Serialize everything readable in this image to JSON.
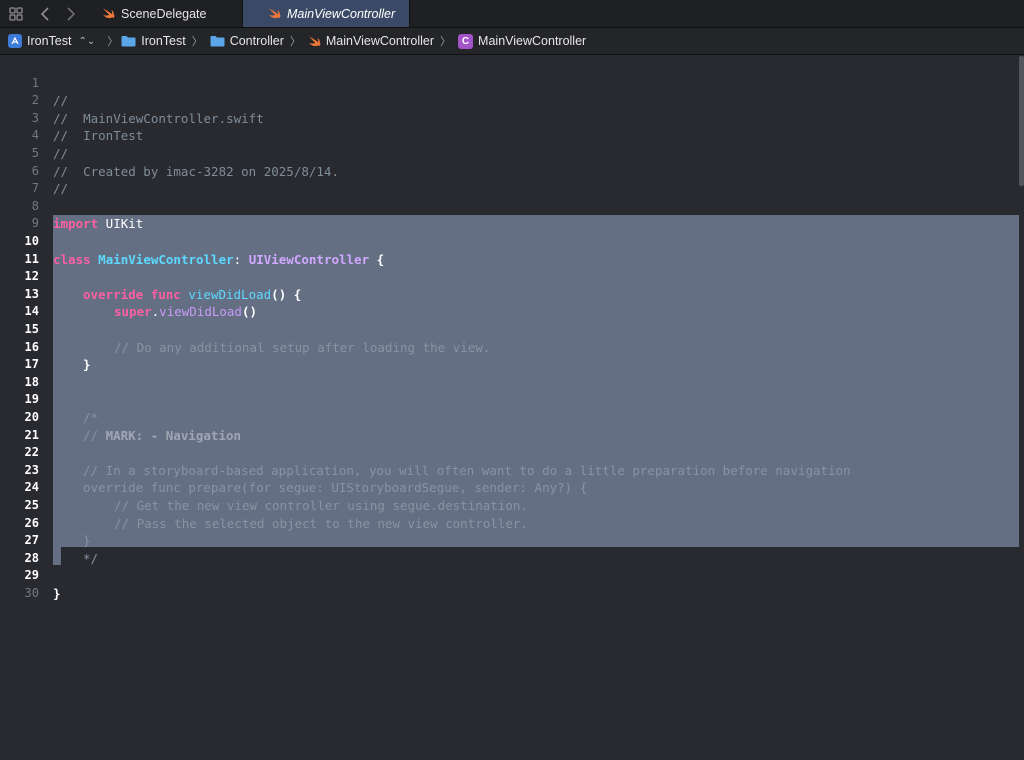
{
  "tabs": {
    "items": [
      {
        "label": "SceneDelegate",
        "icon": "swift-icon",
        "active": false
      },
      {
        "label": "MainViewController",
        "icon": "swift-icon",
        "active": true
      }
    ]
  },
  "breadcrumb": {
    "project": "IronTest",
    "folder1": "IronTest",
    "folder2": "Controller",
    "file": "MainViewController",
    "symbol": "MainViewController",
    "symbol_badge": "C"
  },
  "editor": {
    "lines": [
      {
        "n": "1",
        "text": "//"
      },
      {
        "n": "2",
        "text": "//  MainViewController.swift"
      },
      {
        "n": "3",
        "text": "//  IronTest"
      },
      {
        "n": "4",
        "text": "//"
      },
      {
        "n": "5",
        "text": "//  Created by imac-3282 on 2025/8/14."
      },
      {
        "n": "6",
        "text": "//"
      },
      {
        "n": "7",
        "text": ""
      },
      {
        "n": "8",
        "kw": "import",
        "rest": " UIKit"
      },
      {
        "n": "9",
        "text": ""
      },
      {
        "n": "10",
        "kw": "class",
        "name": "MainViewController",
        "colon": ": ",
        "super": "UIViewController",
        "rest": " {"
      },
      {
        "n": "11",
        "text": ""
      },
      {
        "n": "12",
        "kw": "override func",
        "fn": "viewDidLoad",
        "rest": "() {"
      },
      {
        "n": "13",
        "kw": "super",
        "dot": ".",
        "fn": "viewDidLoad",
        "rest": "()"
      },
      {
        "n": "14",
        "text": ""
      },
      {
        "n": "15",
        "text": "// Do any additional setup after loading the view."
      },
      {
        "n": "16",
        "text": "}"
      },
      {
        "n": "17",
        "text": ""
      },
      {
        "n": "18",
        "text": ""
      },
      {
        "n": "19",
        "text": "/*"
      },
      {
        "n": "20",
        "pre": "// ",
        "mark": "MARK: - Navigation"
      },
      {
        "n": "21",
        "text": ""
      },
      {
        "n": "22",
        "text": "// In a storyboard-based application, you will often want to do a little preparation before navigation"
      },
      {
        "n": "23",
        "text": "override func prepare(for segue: UIStoryboardSegue, sender: Any?) {"
      },
      {
        "n": "24",
        "text": "// Get the new view controller using segue.destination."
      },
      {
        "n": "25",
        "text": "// Pass the selected object to the new view controller."
      },
      {
        "n": "26",
        "text": "}"
      },
      {
        "n": "27",
        "text": "*/"
      },
      {
        "n": "28",
        "text": ""
      },
      {
        "n": "29",
        "text": "}"
      },
      {
        "n": "30",
        "text": ""
      }
    ]
  },
  "colors": {
    "background": "#292a30",
    "selection": "#646f83",
    "keyword": "#fc5fa3",
    "type": "#5dd8ff",
    "comment": "#7f8c98",
    "active_tab": "#3a4a66"
  }
}
